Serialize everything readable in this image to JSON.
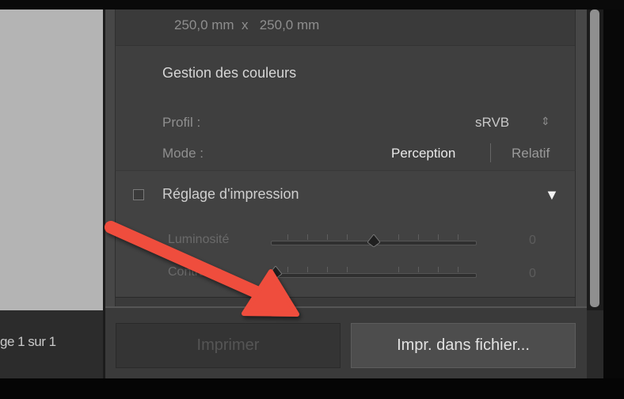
{
  "preview": {
    "page_counter": "ge 1 sur 1"
  },
  "dimensions": {
    "text": "250,0 mm  x   250,0 mm"
  },
  "color_management": {
    "title": "Gestion des couleurs",
    "profile_label": "Profil :",
    "profile_value": "sRVB",
    "profile_arrows": "⇕",
    "mode_label": "Mode :",
    "mode_perception": "Perception",
    "mode_relatif": "Relatif"
  },
  "print_adjustment": {
    "title": "Réglage d'impression",
    "expand_icon": "▼",
    "checked": false,
    "sliders": [
      {
        "label": "Luminosité",
        "value": "0",
        "level": 0.48
      },
      {
        "label": "Contraste",
        "value": "0",
        "level": 0.0
      }
    ]
  },
  "buttons": {
    "print": "Imprimer",
    "print_to_file": "Impr. dans fichier..."
  },
  "annotation": {
    "arrow_color": "#ef4d3c"
  },
  "colors": {
    "panel_bg": "#474747",
    "preview_bg": "#b4b4b4",
    "accent_arrow": "#ef4d3c"
  }
}
